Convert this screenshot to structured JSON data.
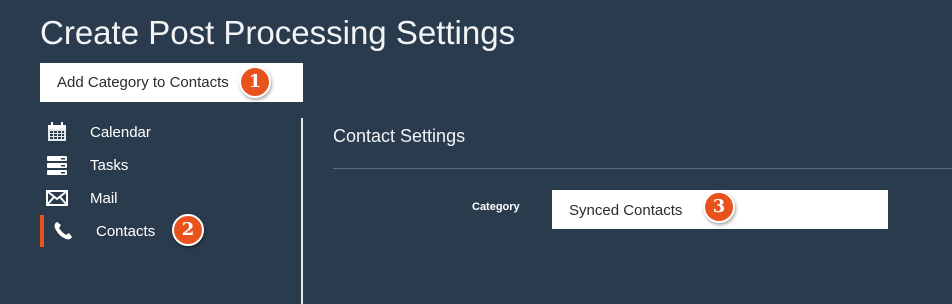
{
  "page": {
    "title": "Create Post Processing Settings"
  },
  "name_field": {
    "value": "Add Category to Contacts"
  },
  "sidebar": {
    "items": [
      {
        "label": "Calendar",
        "icon": "calendar-icon",
        "active": false
      },
      {
        "label": "Tasks",
        "icon": "tasks-icon",
        "active": false
      },
      {
        "label": "Mail",
        "icon": "mail-icon",
        "active": false
      },
      {
        "label": "Contacts",
        "icon": "phone-icon",
        "active": true
      }
    ]
  },
  "settings": {
    "title": "Contact Settings",
    "category_label": "Category",
    "category_value": "Synced Contacts"
  },
  "markers": [
    "1",
    "2",
    "3"
  ],
  "colors": {
    "background": "#2b3b4e",
    "accent": "#e8521c",
    "input_background": "#ffffff"
  }
}
